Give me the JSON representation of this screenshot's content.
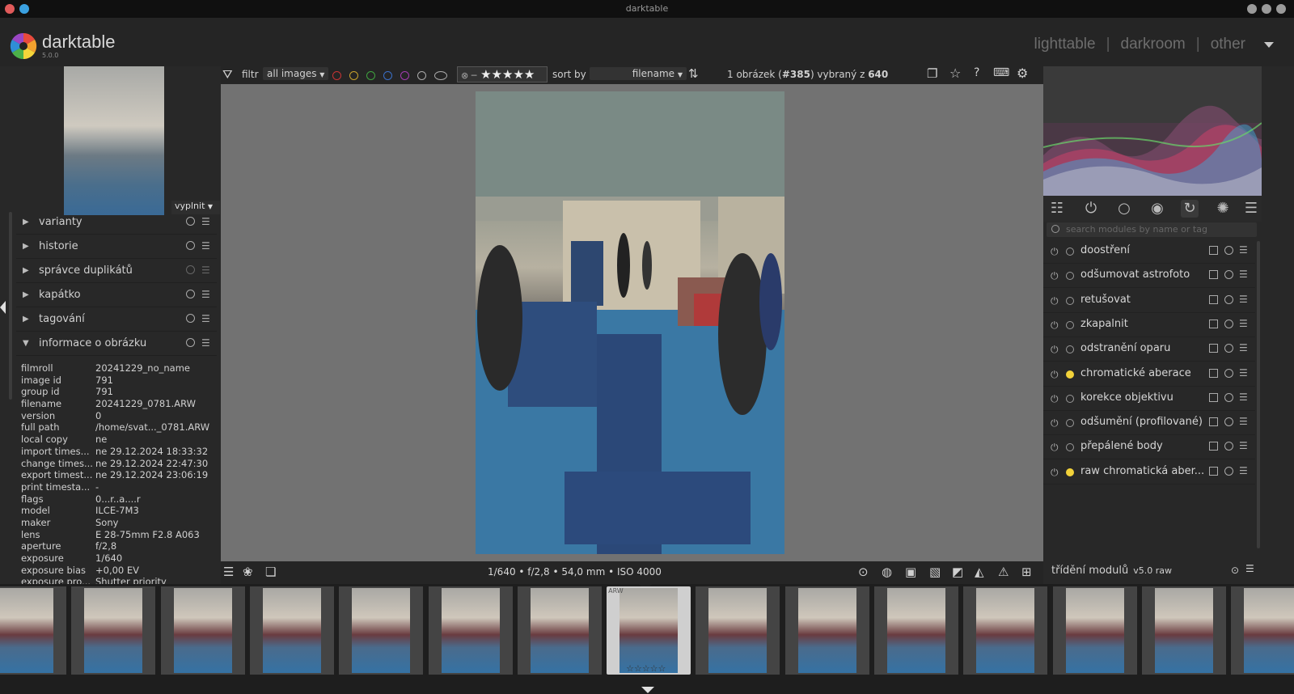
{
  "window": {
    "title": "darktable"
  },
  "app": {
    "name": "darktable",
    "version": "5.0.0"
  },
  "views": {
    "lighttable": "lighttable",
    "darkroom": "darkroom",
    "other": "other",
    "separator": "|"
  },
  "navigation": {
    "fit_label": "vyplnit"
  },
  "left_panel": {
    "modules": [
      {
        "label": "varianty",
        "expanded": false
      },
      {
        "label": "historie",
        "expanded": false
      },
      {
        "label": "správce duplikátů",
        "expanded": false
      },
      {
        "label": "kapátko",
        "expanded": false
      },
      {
        "label": "tagování",
        "expanded": false
      },
      {
        "label": "informace o obrázku",
        "expanded": true
      }
    ],
    "image_info": [
      {
        "key": "filmroll",
        "value": "20241229_no_name"
      },
      {
        "key": "image id",
        "value": "791"
      },
      {
        "key": "group id",
        "value": "791"
      },
      {
        "key": "filename",
        "value": "20241229_0781.ARW"
      },
      {
        "key": "version",
        "value": "0"
      },
      {
        "key": "full path",
        "value": "/home/svat..._0781.ARW"
      },
      {
        "key": "local copy",
        "value": "ne"
      },
      {
        "key": "import times...",
        "value": "ne 29.12.2024 18:33:32"
      },
      {
        "key": "change times...",
        "value": "ne 29.12.2024 22:47:30"
      },
      {
        "key": "export timest...",
        "value": "ne 29.12.2024 23:06:19"
      },
      {
        "key": "print timesta...",
        "value": "-"
      },
      {
        "key": "flags",
        "value": "0...r..a....r"
      },
      {
        "key": "model",
        "value": "ILCE-7M3"
      },
      {
        "key": "maker",
        "value": "Sony"
      },
      {
        "key": "lens",
        "value": "E 28-75mm F2.8 A063"
      },
      {
        "key": "aperture",
        "value": "f/2,8"
      },
      {
        "key": "exposure",
        "value": "1/640"
      },
      {
        "key": "exposure bias",
        "value": "+0,00 EV"
      },
      {
        "key": "exposure pro...",
        "value": "Shutter priority"
      }
    ]
  },
  "toolbar": {
    "filter_label": "filtr",
    "filter_value": "all images",
    "color_labels": [
      "#c83434",
      "#c8a22c",
      "#3fa33f",
      "#3a6fc8",
      "#a43cb0",
      "#aaaaaa",
      "#aaaaaa"
    ],
    "rating_stars": "★★★★★",
    "rating_prefix": "⊗ ─",
    "sort_label": "sort by",
    "sort_value": "filename",
    "selection_count_prefix": "1 obrázek (",
    "selection_count_bold": "#385",
    "selection_count_mid": ") vybraný z ",
    "selection_count_total": "640"
  },
  "bottom_bar": {
    "exif_summary": "1/640 • f/2,8 • 54,0 mm • ISO 4000"
  },
  "right_panel": {
    "search_placeholder": "search modules by name or tag",
    "modules": [
      {
        "label": "doostření",
        "dot": ""
      },
      {
        "label": "odšumovat astrofoto",
        "dot": ""
      },
      {
        "label": "retušovat",
        "dot": ""
      },
      {
        "label": "zkapalnit",
        "dot": ""
      },
      {
        "label": "odstranění oparu",
        "dot": ""
      },
      {
        "label": "chromatické aberace",
        "dot": "#f2d23a"
      },
      {
        "label": "korekce objektivu",
        "dot": ""
      },
      {
        "label": "odšumění (profilované)",
        "dot": ""
      },
      {
        "label": "přepálené body",
        "dot": ""
      },
      {
        "label": "raw chromatická aber...",
        "dot": "#f2d23a"
      }
    ],
    "module_order_label": "třídění modulů",
    "module_order_value": "v5.0 raw"
  },
  "filmstrip": {
    "thumbnail_count": 15,
    "selected_index": 7,
    "selected_badge": "ARW",
    "selected_stars": "☆☆☆☆☆"
  }
}
